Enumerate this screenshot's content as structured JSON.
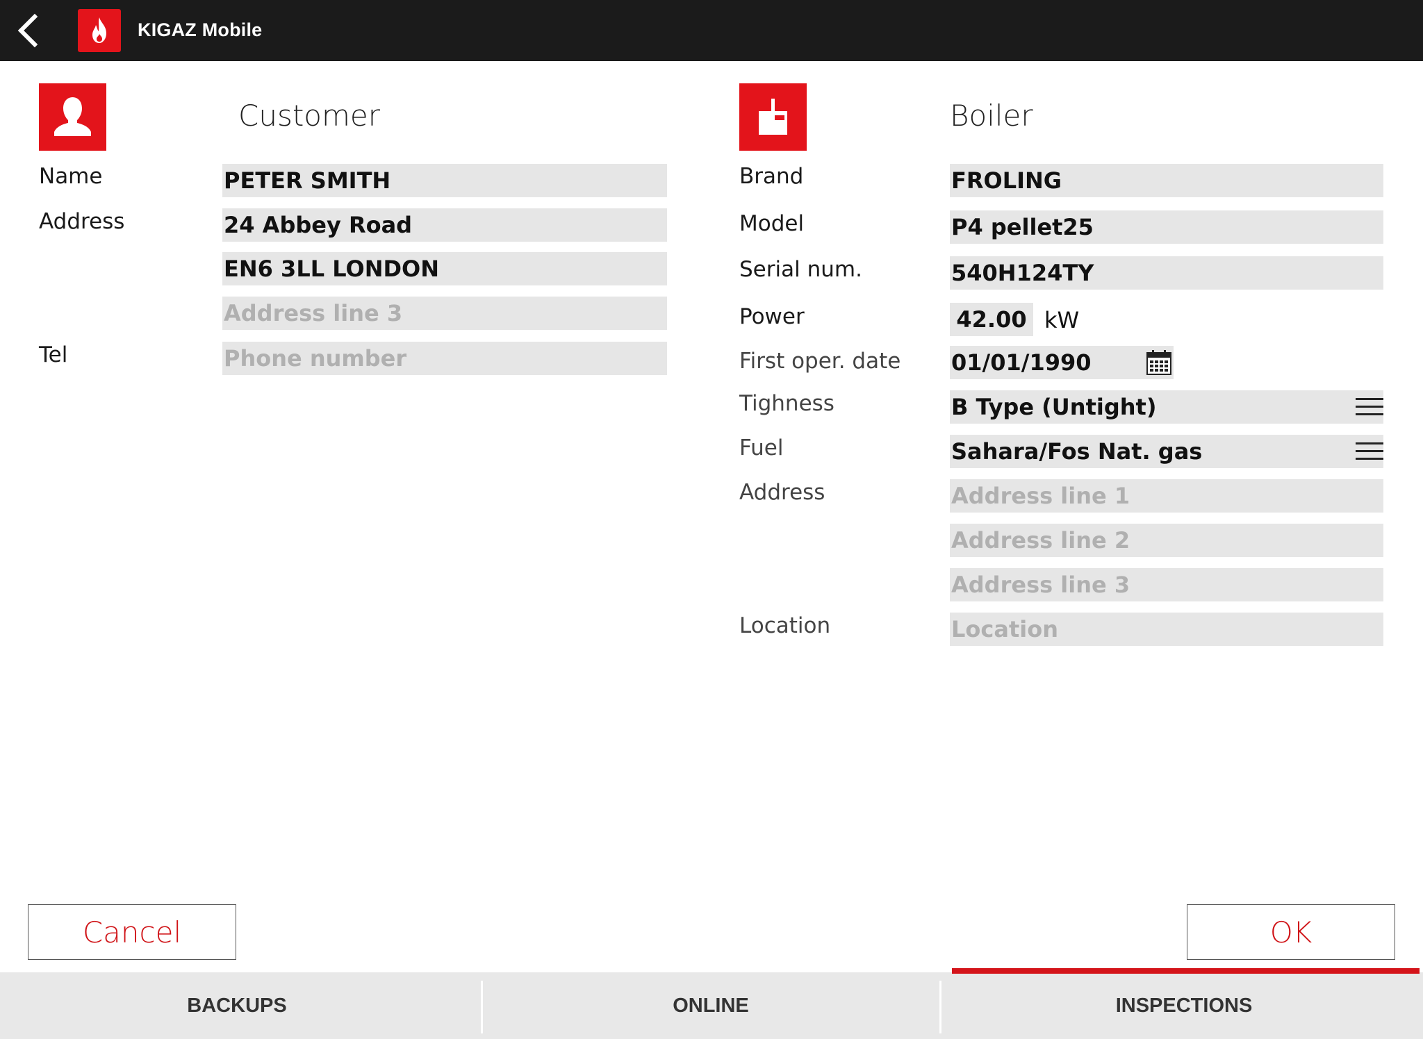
{
  "app": {
    "title": "KIGAZ Mobile",
    "accent_color": "#e3141b",
    "back_icon": "chevron-left-icon",
    "logo_icon": "flame-icon"
  },
  "customer": {
    "title": "Customer",
    "icon": "person-icon",
    "labels": {
      "name": "Name",
      "address": "Address",
      "tel": "Tel"
    },
    "name": {
      "value": "PETER SMITH"
    },
    "address_line_1": {
      "value": "24 Abbey Road"
    },
    "address_line_2": {
      "value": "EN6 3LL LONDON"
    },
    "address_line_3": {
      "value": "",
      "placeholder": "Address line 3"
    },
    "tel": {
      "value": "",
      "placeholder": "Phone number"
    }
  },
  "boiler": {
    "title": "Boiler",
    "icon": "boiler-icon",
    "labels": {
      "brand": "Brand",
      "model": "Model",
      "serial": "Serial num.",
      "power": "Power",
      "first_oper_date": "First oper. date",
      "tighness": "Tighness",
      "fuel": "Fuel",
      "address": "Address",
      "location": "Location"
    },
    "brand": {
      "value": "FROLING"
    },
    "model": {
      "value": "P4 pellet25"
    },
    "serial": {
      "value": "540H124TY"
    },
    "power": {
      "value": "42.00",
      "unit": "kW"
    },
    "first_oper_date": {
      "value": "01/01/1990"
    },
    "tighness": {
      "value": "B Type (Untight)"
    },
    "fuel": {
      "value": "Sahara/Fos Nat. gas"
    },
    "address_line_1": {
      "value": "",
      "placeholder": "Address line 1"
    },
    "address_line_2": {
      "value": "",
      "placeholder": "Address line 2"
    },
    "address_line_3": {
      "value": "",
      "placeholder": "Address line 3"
    },
    "location": {
      "value": "",
      "placeholder": "Location"
    }
  },
  "buttons": {
    "cancel": "Cancel",
    "ok": "OK"
  },
  "tabs": [
    {
      "label": "BACKUPS",
      "active": false
    },
    {
      "label": "ONLINE",
      "active": false
    },
    {
      "label": "INSPECTIONS",
      "active": true
    }
  ]
}
